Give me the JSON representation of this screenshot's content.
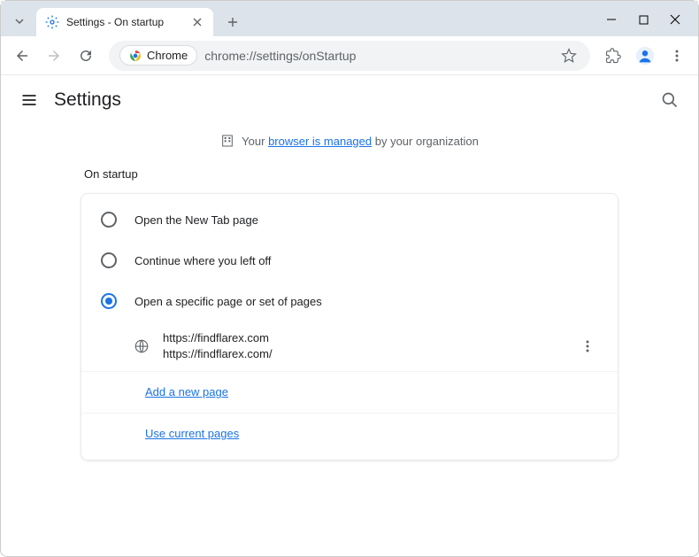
{
  "window": {
    "tab_title": "Settings - On startup"
  },
  "omnibox": {
    "chip_label": "Chrome",
    "url": "chrome://settings/onStartup"
  },
  "header": {
    "title": "Settings"
  },
  "banner": {
    "prefix": "Your ",
    "link": "browser is managed",
    "suffix": " by your organization"
  },
  "section": {
    "title": "On startup",
    "options": [
      "Open the New Tab page",
      "Continue where you left off",
      "Open a specific page or set of pages"
    ],
    "startup_page": {
      "title": "https://findflarex.com",
      "url": "https://findflarex.com/"
    },
    "add_link": "Add a new page",
    "use_current_link": "Use current pages"
  }
}
